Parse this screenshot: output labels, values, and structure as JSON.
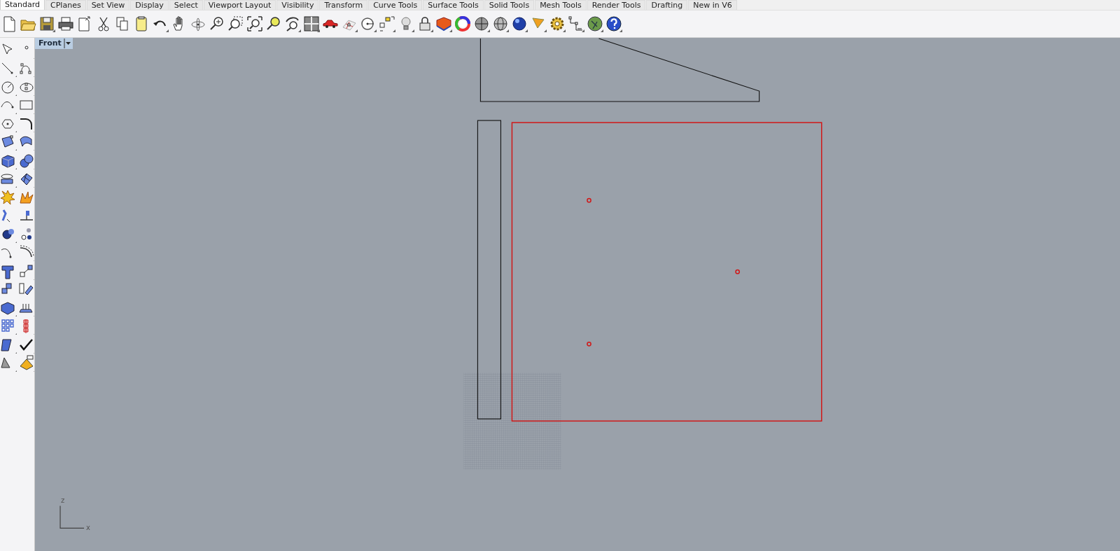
{
  "tabs": [
    {
      "label": "Standard",
      "selected": true
    },
    {
      "label": "CPlanes",
      "selected": false
    },
    {
      "label": "Set View",
      "selected": false
    },
    {
      "label": "Display",
      "selected": false
    },
    {
      "label": "Select",
      "selected": false
    },
    {
      "label": "Viewport Layout",
      "selected": false
    },
    {
      "label": "Visibility",
      "selected": false
    },
    {
      "label": "Transform",
      "selected": false
    },
    {
      "label": "Curve Tools",
      "selected": false
    },
    {
      "label": "Surface Tools",
      "selected": false
    },
    {
      "label": "Solid Tools",
      "selected": false
    },
    {
      "label": "Mesh Tools",
      "selected": false
    },
    {
      "label": "Render Tools",
      "selected": false
    },
    {
      "label": "Drafting",
      "selected": false
    },
    {
      "label": "New in V6",
      "selected": false
    }
  ],
  "viewport": {
    "title": "Front",
    "objects": [
      {
        "kind": "polyline",
        "selected": false
      },
      {
        "kind": "rectangle",
        "selected": false
      },
      {
        "kind": "rectangle",
        "selected": true
      },
      {
        "kind": "point",
        "selected": true
      },
      {
        "kind": "point",
        "selected": true
      },
      {
        "kind": "point",
        "selected": true
      },
      {
        "kind": "mesh"
      }
    ],
    "axis": {
      "z_label": "z",
      "x_label": "x"
    }
  }
}
